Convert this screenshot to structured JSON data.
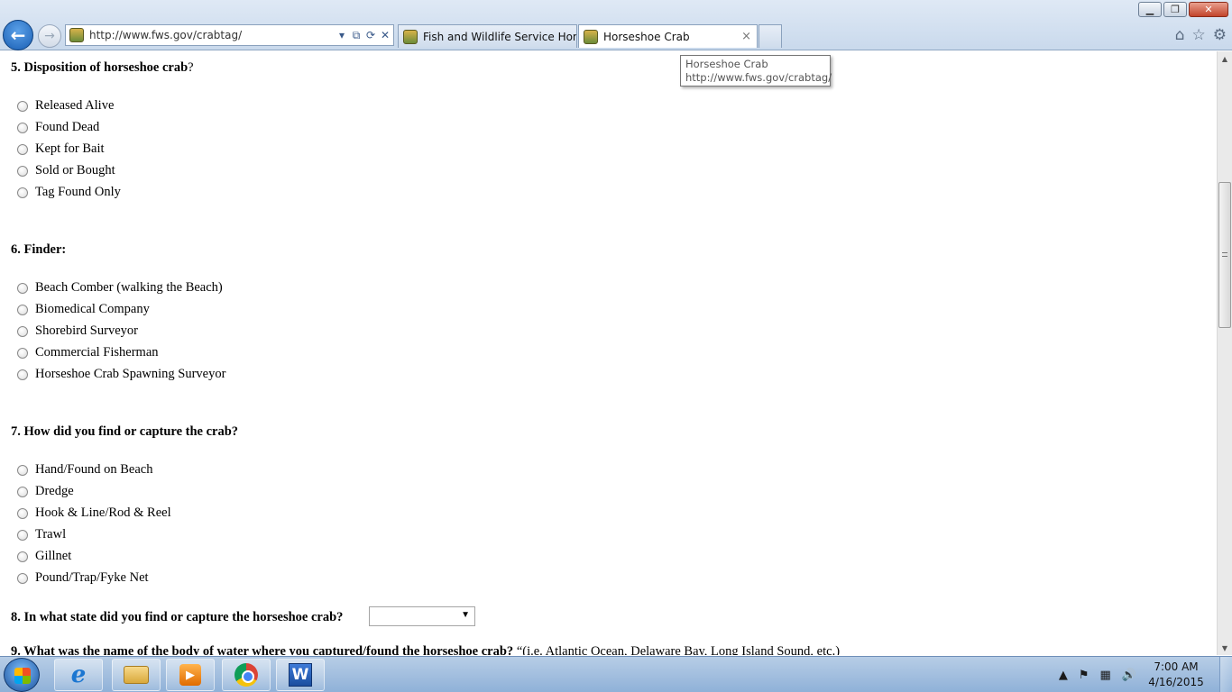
{
  "browser": {
    "url": "http://www.fws.gov/crabtag/",
    "tabs": [
      {
        "title": "Fish and Wildlife Service Hom..."
      },
      {
        "title": "Horseshoe Crab",
        "close": "×"
      }
    ],
    "tooltip": {
      "title": "Horseshoe Crab",
      "url": "http://www.fws.gov/crabtag/"
    },
    "window_controls": {
      "minimize": "▁",
      "restore": "❐",
      "close": "✕"
    },
    "icons": {
      "back": "←",
      "forward": "→",
      "dropdown": "▾",
      "compat": "⧉",
      "refresh": "⟳",
      "stop": "✕",
      "home": "⌂",
      "favorites": "☆",
      "tools": "⚙"
    }
  },
  "form": {
    "q5": {
      "label": "5. Disposition of horseshoe crab",
      "suffix": "?",
      "options": [
        "Released Alive",
        "Found Dead",
        "Kept for Bait",
        "Sold or Bought",
        "Tag Found Only"
      ]
    },
    "q6": {
      "label": "6. Finder:",
      "options": [
        "Beach Comber (walking the Beach)",
        "Biomedical Company",
        "Shorebird Surveyor",
        "Commercial Fisherman",
        "Horseshoe Crab Spawning Surveyor"
      ]
    },
    "q7": {
      "label": "7. How did you find or capture the crab?",
      "options": [
        "Hand/Found on Beach",
        "Dredge",
        "Hook & Line/Rod & Reel",
        "Trawl",
        "Gillnet",
        "Pound/Trap/Fyke Net"
      ]
    },
    "q8": {
      "label": "8. In what state did you find or capture the horseshoe crab?",
      "selected": "",
      "arrow": "▼"
    },
    "q9": {
      "label": "9. What was the name of the body of water where you captured/found the horseshoe crab?",
      "hint": " “(i.e. Atlantic Ocean, Delaware Bay, Long Island Sound, etc.)"
    }
  },
  "scrollbar": {
    "up": "▲",
    "down": "▼"
  },
  "taskbar": {
    "clock_time": "7:00 AM",
    "clock_date": "4/16/2015",
    "tray": {
      "chevron": "▲",
      "flag": "⚑",
      "network": "▦",
      "volume": "🔊"
    },
    "apps": [
      "internet-explorer",
      "file-explorer",
      "media-player",
      "chrome",
      "word"
    ],
    "word_letter": "W",
    "ie_letter": "e",
    "media_glyph": "▶"
  }
}
